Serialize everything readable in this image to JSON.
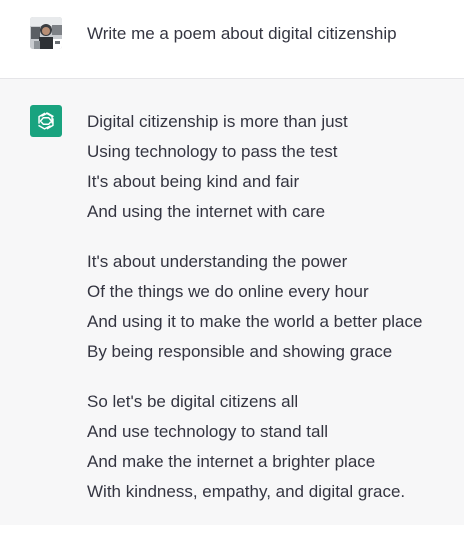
{
  "user_message": {
    "avatar": "user-photo-icon",
    "text": "Write me a poem about digital citizenship"
  },
  "assistant_message": {
    "avatar": "openai-logo-icon",
    "brand_color": "#19a37f",
    "stanzas": [
      {
        "lines": [
          "Digital citizenship is more than just",
          "Using technology to pass the test",
          "It's about being kind and fair",
          "And using the internet with care"
        ]
      },
      {
        "lines": [
          "It's about understanding the power",
          "Of the things we do online every hour",
          "And using it to make the world a better place",
          "By being responsible and showing grace"
        ]
      },
      {
        "lines": [
          "So let's be digital citizens all",
          "And use technology to stand tall",
          "And make the internet a brighter place",
          "With kindness, empathy, and digital grace."
        ]
      }
    ]
  }
}
